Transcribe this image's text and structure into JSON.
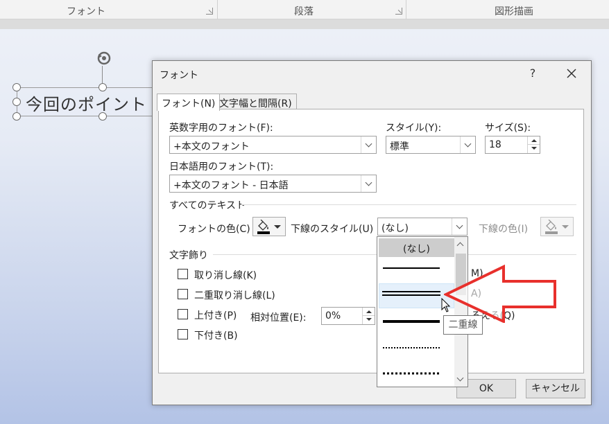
{
  "ribbon": {
    "groups": [
      "フォント",
      "段落",
      "図形描画"
    ]
  },
  "slide": {
    "textbox_text": "今回のポイント"
  },
  "dialog": {
    "title": "フォント",
    "help_label": "?",
    "tabs": [
      "フォント(N)",
      "文字幅と間隔(R)"
    ],
    "latin_font": {
      "label": "英数字用のフォント(F):",
      "value": "+本文のフォント"
    },
    "style": {
      "label": "スタイル(Y):",
      "value": "標準"
    },
    "size": {
      "label": "サイズ(S):",
      "value": "18"
    },
    "asian_font": {
      "label": "日本語用のフォント(T):",
      "value": "+本文のフォント - 日本語"
    },
    "all_text": {
      "heading": "すべてのテキスト",
      "font_color_label": "フォントの色(C)",
      "font_color": "#000000",
      "underline_style_label": "下線のスタイル(U)",
      "underline_style_value": "(なし)",
      "underline_color_label": "下線の色(I)"
    },
    "effects": {
      "heading": "文字飾り",
      "strikethrough": {
        "label": "取り消し線(K)",
        "checked": false
      },
      "double_strikethrough": {
        "label": "二重取り消し線(L)",
        "checked": false
      },
      "superscript": {
        "label": "上付き(P)",
        "checked": false
      },
      "offset": {
        "label": "相対位置(E):",
        "value": "0%"
      },
      "subscript": {
        "label": "下付き(B)",
        "checked": false
      },
      "right_partial": [
        "M)",
        "A)",
        "ろえる(Q)"
      ]
    },
    "buttons": {
      "ok": "OK",
      "cancel": "キャンセル"
    }
  },
  "underline_dropdown": {
    "items": [
      "(なし)",
      "single",
      "double",
      "thick",
      "dotted",
      "dotted-heavy"
    ],
    "selected": "(なし)",
    "hovered": "double",
    "tooltip": "二重線"
  },
  "colors": {
    "annotation_arrow": "#e8302c",
    "selection_gray": "#cdcdcd"
  }
}
